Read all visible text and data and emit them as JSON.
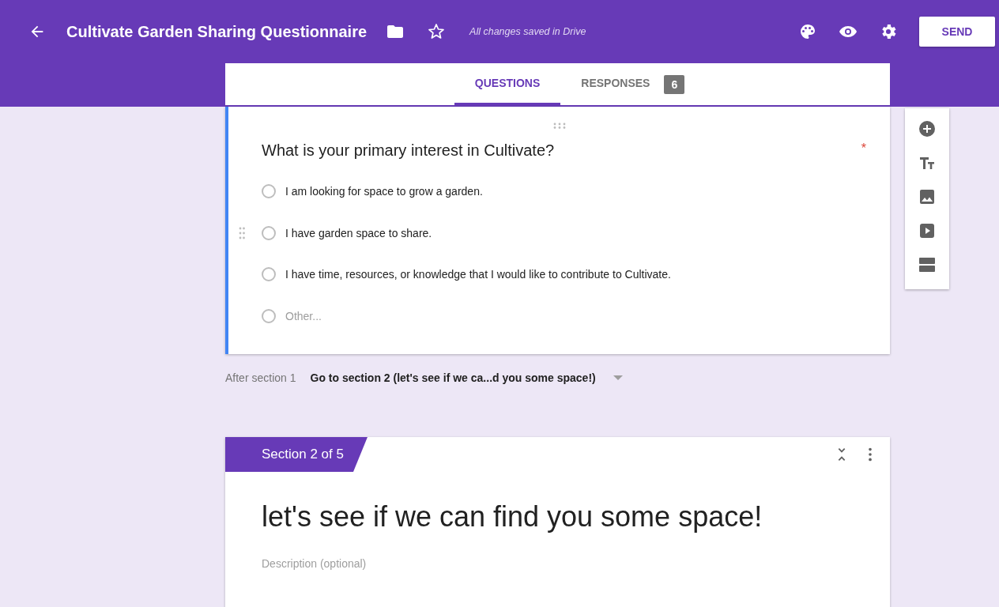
{
  "header": {
    "title": "Cultivate Garden Sharing Questionnaire",
    "save_status": "All changes saved in Drive",
    "send_button": "SEND"
  },
  "tabs": [
    {
      "label": "QUESTIONS",
      "selected": true
    },
    {
      "label": "RESPONSES",
      "selected": false,
      "badge": "6"
    }
  ],
  "question": {
    "title": "What is your primary interest in Cultivate?",
    "required_mark": "*",
    "options": [
      {
        "kind": "option",
        "label": "I am looking for space to grow a garden.",
        "selected": false
      },
      {
        "kind": "option",
        "label": "I have garden space to share.",
        "selected": false
      },
      {
        "kind": "option",
        "label": "I have time, resources, or knowledge that I would like to contribute to Cultivate.",
        "selected": false
      },
      {
        "kind": "other",
        "label": "Other...",
        "selected": false
      }
    ]
  },
  "after_section": {
    "label": "After section 1",
    "value": "Go to section 2 (let's see if we ca...d you some space!)"
  },
  "section": {
    "tag": "Section 2 of 5",
    "title": "let's see if we can find you some space!",
    "description_placeholder": "Description (optional)"
  }
}
